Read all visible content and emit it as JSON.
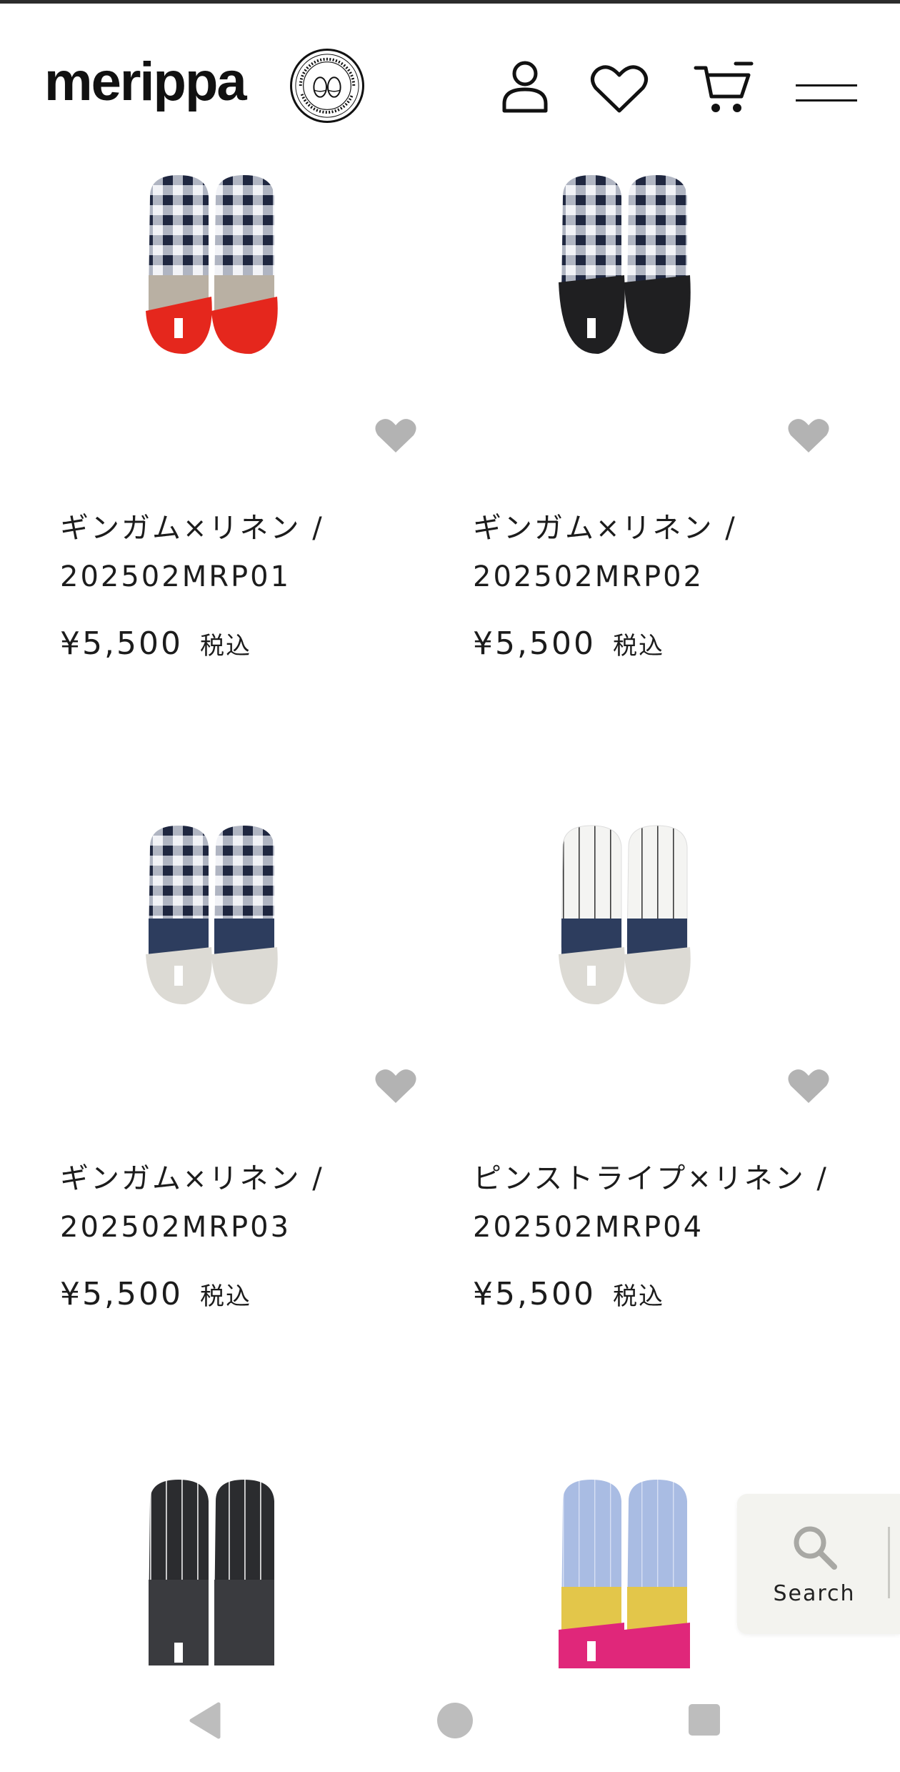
{
  "header": {
    "logo": "merippa",
    "badge_text": "made in japan merippa http://www.merippa.com",
    "icons": [
      "account-icon",
      "favorite-icon",
      "cart-icon",
      "menu-icon"
    ]
  },
  "products": [
    {
      "name": "ギンガム×リネン / 202502MRP01",
      "price": "¥5,500",
      "tax": "税込",
      "style": "gingham-red"
    },
    {
      "name": "ギンガム×リネン / 202502MRP02",
      "price": "¥5,500",
      "tax": "税込",
      "style": "gingham-black"
    },
    {
      "name": "ギンガム×リネン / 202502MRP03",
      "price": "¥5,500",
      "tax": "税込",
      "style": "gingham-gray"
    },
    {
      "name": "ピンストライプ×リネン / 202502MRP04",
      "price": "¥5,500",
      "tax": "税込",
      "style": "pinstripe-white"
    }
  ],
  "partial_products": [
    {
      "style": "pinstripe-black"
    },
    {
      "style": "blue-yellow-pink"
    }
  ],
  "search": {
    "label": "Search"
  },
  "colors": {
    "heart": "#b3b3b3",
    "text": "#1c1c1c",
    "search_bg": "#f3f3ef",
    "nav_icon": "#bdbdbd"
  }
}
